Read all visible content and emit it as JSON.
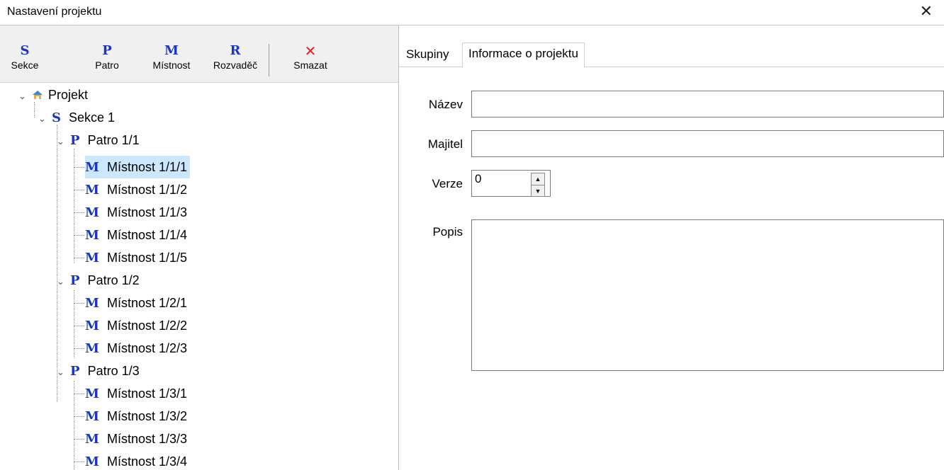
{
  "window": {
    "title": "Nastavení projektu",
    "close_glyph": "✕"
  },
  "toolbar": {
    "buttons": [
      {
        "icon": "S",
        "label": "Sekce"
      },
      {
        "icon": "P",
        "label": "Patro"
      },
      {
        "icon": "M",
        "label": "Místnost"
      },
      {
        "icon": "R",
        "label": "Rozvaděč"
      },
      {
        "icon": "✕",
        "label": "Smazat"
      }
    ]
  },
  "tree": {
    "root": "Projekt",
    "section": "Sekce 1",
    "floors": [
      {
        "label": "Patro 1/1",
        "rooms": [
          "Místnost 1/1/1",
          "Místnost 1/1/2",
          "Místnost 1/1/3",
          "Místnost 1/1/4",
          "Místnost 1/1/5"
        ]
      },
      {
        "label": "Patro 1/2",
        "rooms": [
          "Místnost 1/2/1",
          "Místnost 1/2/2",
          "Místnost 1/2/3"
        ]
      },
      {
        "label": "Patro 1/3",
        "rooms": [
          "Místnost 1/3/1",
          "Místnost 1/3/2",
          "Místnost 1/3/3",
          "Místnost 1/3/4"
        ]
      }
    ],
    "selected": "Místnost 1/1/1",
    "letters": {
      "section": "S",
      "floor": "P",
      "room": "M"
    }
  },
  "tabs": [
    {
      "label": "Skupiny"
    },
    {
      "label": "Informace o projektu"
    }
  ],
  "form": {
    "name_label": "Název",
    "name_value": "",
    "owner_label": "Majitel",
    "owner_value": "",
    "version_label": "Verze",
    "version_value": "0",
    "desc_label": "Popis",
    "desc_value": ""
  }
}
